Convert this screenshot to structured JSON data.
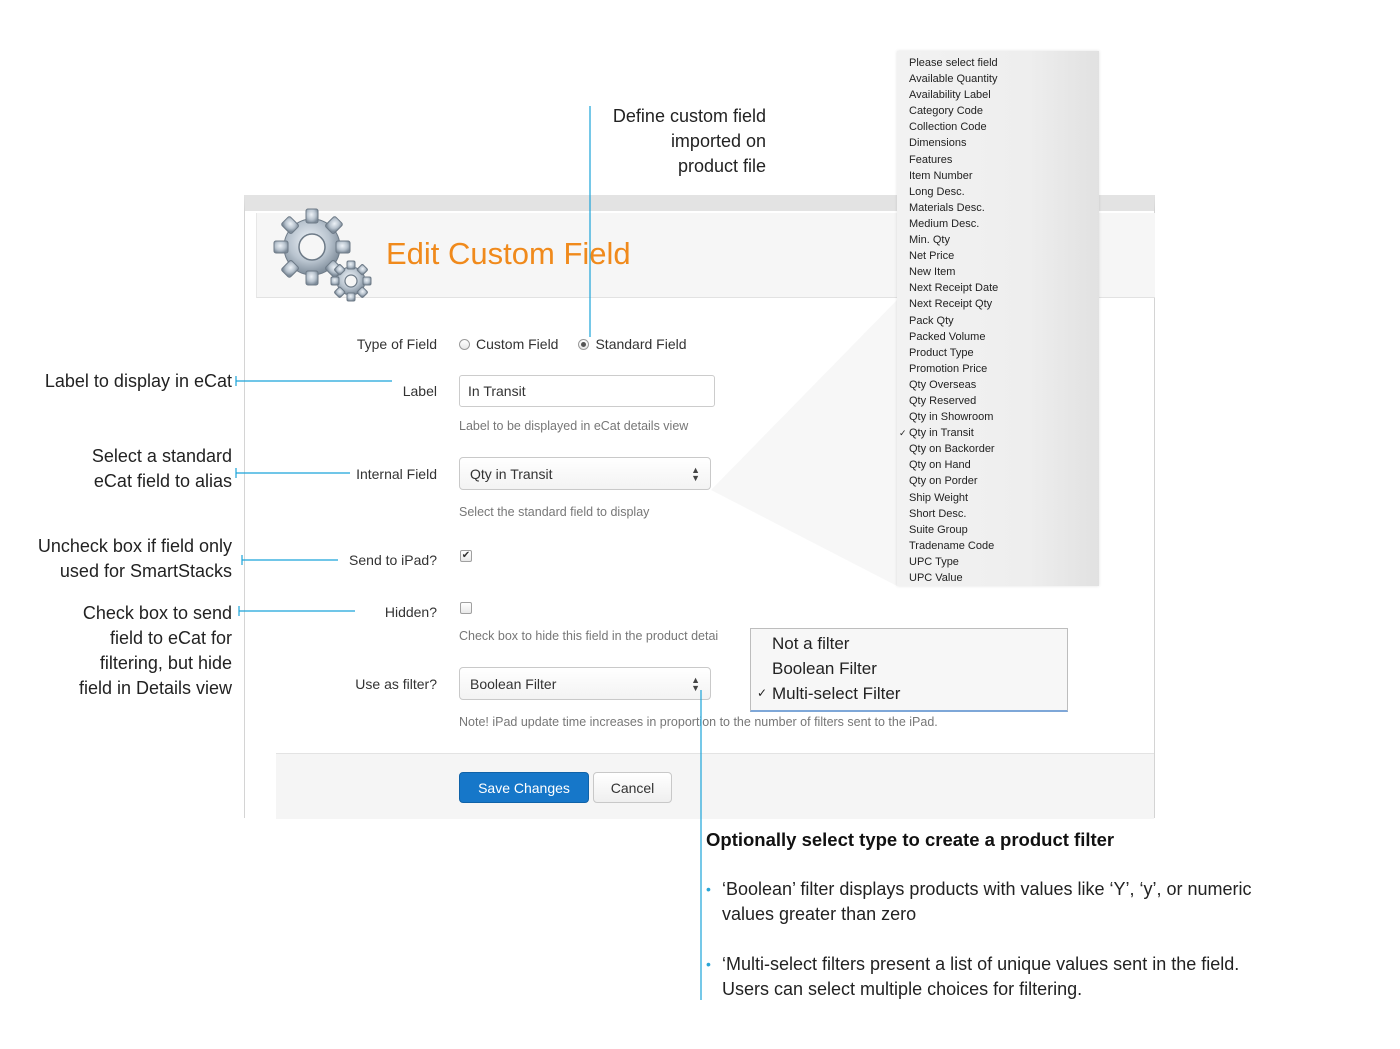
{
  "panel": {
    "title": "Edit Custom Field"
  },
  "form": {
    "type_of_field": {
      "label": "Type of Field",
      "options": [
        {
          "label": "Custom Field",
          "checked": false
        },
        {
          "label": "Standard Field",
          "checked": true
        }
      ]
    },
    "label_field": {
      "label": "Label",
      "value": "In Transit",
      "help": "Label to be displayed in eCat details view"
    },
    "internal_field": {
      "label": "Internal Field",
      "value": "Qty in Transit",
      "help": "Select the standard field to display"
    },
    "send_to_ipad": {
      "label": "Send to iPad?",
      "checked": true
    },
    "hidden": {
      "label": "Hidden?",
      "checked": false,
      "help": "Check box to hide this field in the product detai"
    },
    "use_as_filter": {
      "label": "Use as filter?",
      "value": "Boolean Filter",
      "help": "Note! iPad update time increases in proportion to the number of filters sent to the iPad."
    },
    "save_label": "Save Changes",
    "cancel_label": "Cancel"
  },
  "field_options": [
    "Please select field",
    "Available Quantity",
    "Availability Label",
    "Category Code",
    "Collection Code",
    "Dimensions",
    "Features",
    "Item Number",
    "Long Desc.",
    "Materials Desc.",
    "Medium Desc.",
    "Min. Qty",
    "Net Price",
    "New Item",
    "Next Receipt Date",
    "Next Receipt Qty",
    "Pack Qty",
    "Packed Volume",
    "Product Type",
    "Promotion Price",
    "Qty Overseas",
    "Qty Reserved",
    "Qty in Showroom",
    "Qty in Transit",
    "Qty on Backorder",
    "Qty on Hand",
    "Qty on Porder",
    "Ship Weight",
    "Short Desc.",
    "Suite Group",
    "Tradename Code",
    "UPC Type",
    "UPC Value"
  ],
  "field_options_selected": "Qty in Transit",
  "filter_options": [
    "Not a filter",
    "Boolean Filter",
    "Multi-select Filter"
  ],
  "filter_options_selected": "Multi-select Filter",
  "annotations": {
    "custom_field": [
      "Define custom field",
      "imported on",
      "product file"
    ],
    "label": [
      "Label to display in eCat"
    ],
    "internal": [
      "Select a standard",
      "eCat field to alias"
    ],
    "send": [
      "Uncheck box  if field only",
      "used for SmartStacks"
    ],
    "hidden": [
      "Check box to send",
      "field to eCat for",
      "filtering, but hide",
      "field in Details view"
    ],
    "filter_heading": "Optionally select type to create a product filter",
    "filter_bullets": [
      [
        "‘Boolean’ filter displays products with values like ‘Y’, ‘y’, or numeric",
        "values greater than zero"
      ],
      [
        "‘Multi-select filters present a list of unique values sent in the field.",
        "Users can select multiple choices for filtering."
      ]
    ]
  },
  "colors": {
    "title_orange": "#f08a1c",
    "primary_blue": "#1677c9",
    "annotation_line": "#1aa3d9"
  }
}
